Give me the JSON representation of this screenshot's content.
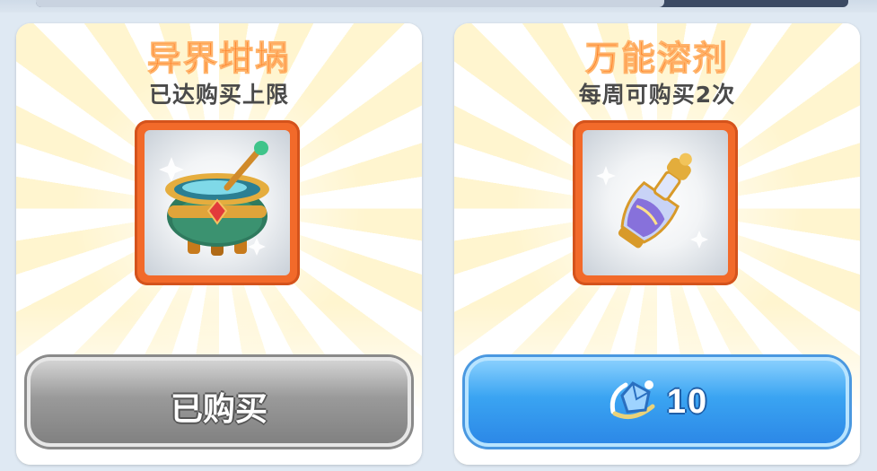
{
  "items": [
    {
      "name": "异界坩埚",
      "status": "已达购买上限",
      "icon": "cauldron-icon",
      "button_label": "已购买",
      "button_state": "disabled"
    },
    {
      "name": "万能溶剂",
      "status": "每周可购买2次",
      "icon": "solvent-bottle-icon",
      "price": "10",
      "currency_icon": "crystal-currency-icon",
      "button_state": "active"
    }
  ],
  "colors": {
    "title": "#ff7a1f",
    "frame": "#f26a2a",
    "button_gray": "#8f8f8f",
    "button_blue": "#3aa4f2"
  }
}
